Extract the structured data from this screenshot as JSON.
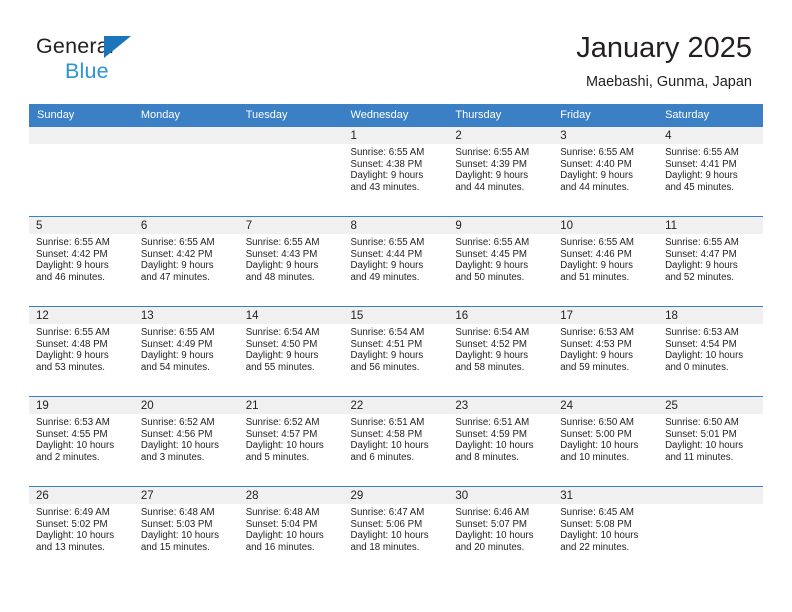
{
  "brand": {
    "name_top": "General",
    "name_bottom": "Blue",
    "accent_color": "#2b93d6",
    "triangle_color": "#1b75bb",
    "logo_icon": "triangle-icon"
  },
  "header": {
    "title": "January 2025",
    "subtitle": "Maebashi, Gunma, Japan"
  },
  "calendar": {
    "header_bg": "#3b7fc4",
    "daynum_bg": "#f0f0f0",
    "weekdays": [
      "Sunday",
      "Monday",
      "Tuesday",
      "Wednesday",
      "Thursday",
      "Friday",
      "Saturday"
    ],
    "weeks": [
      [
        {
          "day": "",
          "sunrise": "",
          "sunset": "",
          "daylight1": "",
          "daylight2": ""
        },
        {
          "day": "",
          "sunrise": "",
          "sunset": "",
          "daylight1": "",
          "daylight2": ""
        },
        {
          "day": "",
          "sunrise": "",
          "sunset": "",
          "daylight1": "",
          "daylight2": ""
        },
        {
          "day": "1",
          "sunrise": "Sunrise: 6:55 AM",
          "sunset": "Sunset: 4:38 PM",
          "daylight1": "Daylight: 9 hours",
          "daylight2": "and 43 minutes."
        },
        {
          "day": "2",
          "sunrise": "Sunrise: 6:55 AM",
          "sunset": "Sunset: 4:39 PM",
          "daylight1": "Daylight: 9 hours",
          "daylight2": "and 44 minutes."
        },
        {
          "day": "3",
          "sunrise": "Sunrise: 6:55 AM",
          "sunset": "Sunset: 4:40 PM",
          "daylight1": "Daylight: 9 hours",
          "daylight2": "and 44 minutes."
        },
        {
          "day": "4",
          "sunrise": "Sunrise: 6:55 AM",
          "sunset": "Sunset: 4:41 PM",
          "daylight1": "Daylight: 9 hours",
          "daylight2": "and 45 minutes."
        }
      ],
      [
        {
          "day": "5",
          "sunrise": "Sunrise: 6:55 AM",
          "sunset": "Sunset: 4:42 PM",
          "daylight1": "Daylight: 9 hours",
          "daylight2": "and 46 minutes."
        },
        {
          "day": "6",
          "sunrise": "Sunrise: 6:55 AM",
          "sunset": "Sunset: 4:42 PM",
          "daylight1": "Daylight: 9 hours",
          "daylight2": "and 47 minutes."
        },
        {
          "day": "7",
          "sunrise": "Sunrise: 6:55 AM",
          "sunset": "Sunset: 4:43 PM",
          "daylight1": "Daylight: 9 hours",
          "daylight2": "and 48 minutes."
        },
        {
          "day": "8",
          "sunrise": "Sunrise: 6:55 AM",
          "sunset": "Sunset: 4:44 PM",
          "daylight1": "Daylight: 9 hours",
          "daylight2": "and 49 minutes."
        },
        {
          "day": "9",
          "sunrise": "Sunrise: 6:55 AM",
          "sunset": "Sunset: 4:45 PM",
          "daylight1": "Daylight: 9 hours",
          "daylight2": "and 50 minutes."
        },
        {
          "day": "10",
          "sunrise": "Sunrise: 6:55 AM",
          "sunset": "Sunset: 4:46 PM",
          "daylight1": "Daylight: 9 hours",
          "daylight2": "and 51 minutes."
        },
        {
          "day": "11",
          "sunrise": "Sunrise: 6:55 AM",
          "sunset": "Sunset: 4:47 PM",
          "daylight1": "Daylight: 9 hours",
          "daylight2": "and 52 minutes."
        }
      ],
      [
        {
          "day": "12",
          "sunrise": "Sunrise: 6:55 AM",
          "sunset": "Sunset: 4:48 PM",
          "daylight1": "Daylight: 9 hours",
          "daylight2": "and 53 minutes."
        },
        {
          "day": "13",
          "sunrise": "Sunrise: 6:55 AM",
          "sunset": "Sunset: 4:49 PM",
          "daylight1": "Daylight: 9 hours",
          "daylight2": "and 54 minutes."
        },
        {
          "day": "14",
          "sunrise": "Sunrise: 6:54 AM",
          "sunset": "Sunset: 4:50 PM",
          "daylight1": "Daylight: 9 hours",
          "daylight2": "and 55 minutes."
        },
        {
          "day": "15",
          "sunrise": "Sunrise: 6:54 AM",
          "sunset": "Sunset: 4:51 PM",
          "daylight1": "Daylight: 9 hours",
          "daylight2": "and 56 minutes."
        },
        {
          "day": "16",
          "sunrise": "Sunrise: 6:54 AM",
          "sunset": "Sunset: 4:52 PM",
          "daylight1": "Daylight: 9 hours",
          "daylight2": "and 58 minutes."
        },
        {
          "day": "17",
          "sunrise": "Sunrise: 6:53 AM",
          "sunset": "Sunset: 4:53 PM",
          "daylight1": "Daylight: 9 hours",
          "daylight2": "and 59 minutes."
        },
        {
          "day": "18",
          "sunrise": "Sunrise: 6:53 AM",
          "sunset": "Sunset: 4:54 PM",
          "daylight1": "Daylight: 10 hours",
          "daylight2": "and 0 minutes."
        }
      ],
      [
        {
          "day": "19",
          "sunrise": "Sunrise: 6:53 AM",
          "sunset": "Sunset: 4:55 PM",
          "daylight1": "Daylight: 10 hours",
          "daylight2": "and 2 minutes."
        },
        {
          "day": "20",
          "sunrise": "Sunrise: 6:52 AM",
          "sunset": "Sunset: 4:56 PM",
          "daylight1": "Daylight: 10 hours",
          "daylight2": "and 3 minutes."
        },
        {
          "day": "21",
          "sunrise": "Sunrise: 6:52 AM",
          "sunset": "Sunset: 4:57 PM",
          "daylight1": "Daylight: 10 hours",
          "daylight2": "and 5 minutes."
        },
        {
          "day": "22",
          "sunrise": "Sunrise: 6:51 AM",
          "sunset": "Sunset: 4:58 PM",
          "daylight1": "Daylight: 10 hours",
          "daylight2": "and 6 minutes."
        },
        {
          "day": "23",
          "sunrise": "Sunrise: 6:51 AM",
          "sunset": "Sunset: 4:59 PM",
          "daylight1": "Daylight: 10 hours",
          "daylight2": "and 8 minutes."
        },
        {
          "day": "24",
          "sunrise": "Sunrise: 6:50 AM",
          "sunset": "Sunset: 5:00 PM",
          "daylight1": "Daylight: 10 hours",
          "daylight2": "and 10 minutes."
        },
        {
          "day": "25",
          "sunrise": "Sunrise: 6:50 AM",
          "sunset": "Sunset: 5:01 PM",
          "daylight1": "Daylight: 10 hours",
          "daylight2": "and 11 minutes."
        }
      ],
      [
        {
          "day": "26",
          "sunrise": "Sunrise: 6:49 AM",
          "sunset": "Sunset: 5:02 PM",
          "daylight1": "Daylight: 10 hours",
          "daylight2": "and 13 minutes."
        },
        {
          "day": "27",
          "sunrise": "Sunrise: 6:48 AM",
          "sunset": "Sunset: 5:03 PM",
          "daylight1": "Daylight: 10 hours",
          "daylight2": "and 15 minutes."
        },
        {
          "day": "28",
          "sunrise": "Sunrise: 6:48 AM",
          "sunset": "Sunset: 5:04 PM",
          "daylight1": "Daylight: 10 hours",
          "daylight2": "and 16 minutes."
        },
        {
          "day": "29",
          "sunrise": "Sunrise: 6:47 AM",
          "sunset": "Sunset: 5:06 PM",
          "daylight1": "Daylight: 10 hours",
          "daylight2": "and 18 minutes."
        },
        {
          "day": "30",
          "sunrise": "Sunrise: 6:46 AM",
          "sunset": "Sunset: 5:07 PM",
          "daylight1": "Daylight: 10 hours",
          "daylight2": "and 20 minutes."
        },
        {
          "day": "31",
          "sunrise": "Sunrise: 6:45 AM",
          "sunset": "Sunset: 5:08 PM",
          "daylight1": "Daylight: 10 hours",
          "daylight2": "and 22 minutes."
        },
        {
          "day": "",
          "sunrise": "",
          "sunset": "",
          "daylight1": "",
          "daylight2": ""
        }
      ]
    ]
  }
}
